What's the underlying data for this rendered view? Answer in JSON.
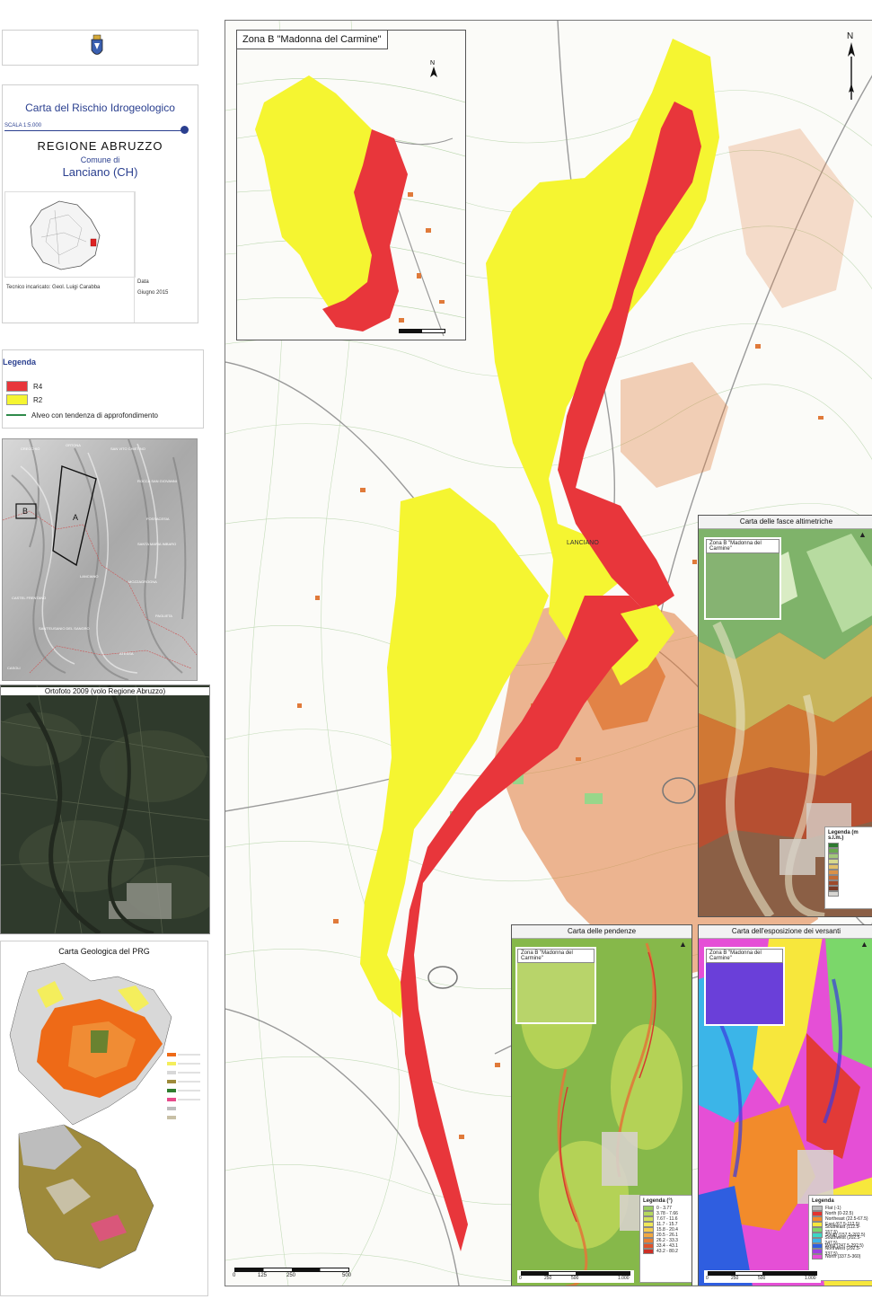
{
  "titlebox": {
    "title": "Carta del Rischio Idrogeologico",
    "scale": "SCALA 1:5.000",
    "region": "REGIONE   ABRUZZO",
    "comune_label": "Comune di",
    "comune": "Lanciano (CH)",
    "technician": "Tecnico incaricato: Geol. Luigi Carabba",
    "date_label": "Data",
    "date": "Giugno 2015"
  },
  "legend": {
    "title": "Legenda",
    "items": [
      {
        "label": "R4",
        "color": "#e8363b"
      },
      {
        "label": "R2",
        "color": "#f5f531"
      }
    ],
    "line_item": "Alveo con tendenza di approfondimento",
    "line_color": "#2f8a4a"
  },
  "overview": {
    "labels": [
      "B",
      "A"
    ]
  },
  "ortho": {
    "title": "Ortofoto 2009 (volo Regione Abruzzo)"
  },
  "geology": {
    "title": "Carta Geologica del PRG"
  },
  "main_map": {
    "inset_title": "Zona B \"Madonna del Carmine\"",
    "place_label": "LANCIANO",
    "north": "N",
    "scalebar": [
      "0",
      "125",
      "250",
      "500"
    ]
  },
  "altimetric": {
    "title": "Carta delle fasce altimetriche",
    "inset": "Zona B \"Madonna del Carmine\"",
    "legend_title": "Legenda (m s.l.m.)"
  },
  "slopes": {
    "title": "Carta delle pendenze",
    "inset": "Zona B \"Madonna del Carmine\"",
    "legend_title": "Legenda (°)",
    "classes": [
      "0 - 3.77",
      "3.78 - 7.66",
      "7.67 - 11.6",
      "11.7 - 15.7",
      "15.8 - 20.4",
      "20.5 - 26.1",
      "26.2 - 33.3",
      "33.4 - 43.1",
      "43.2 - 80.2"
    ],
    "scalebar": [
      "0",
      "250",
      "500",
      "1.000"
    ]
  },
  "aspect": {
    "title": "Carta dell'esposizione dei versanti",
    "inset": "Zona B \"Madonna del Carmine\"",
    "legend_title": "Legenda",
    "classes": [
      "Flat (-1)",
      "North (0-22.5)",
      "Northeast (22.5-67.5)",
      "East (67.5-112.5)",
      "Southeast (112.5-157.5)",
      "South (157.5-202.5)",
      "Southwest (202.5-247.5)",
      "West (247.5-292.5)",
      "Northwest (292.5-337.5)",
      "North (337.5-360)"
    ],
    "scalebar": [
      "0",
      "250",
      "500",
      "1.000"
    ]
  },
  "colors": {
    "r4": "#e8363b",
    "r2": "#f5f531",
    "urban": "#e07a3a",
    "frame_blue": "#2a3f8f"
  }
}
